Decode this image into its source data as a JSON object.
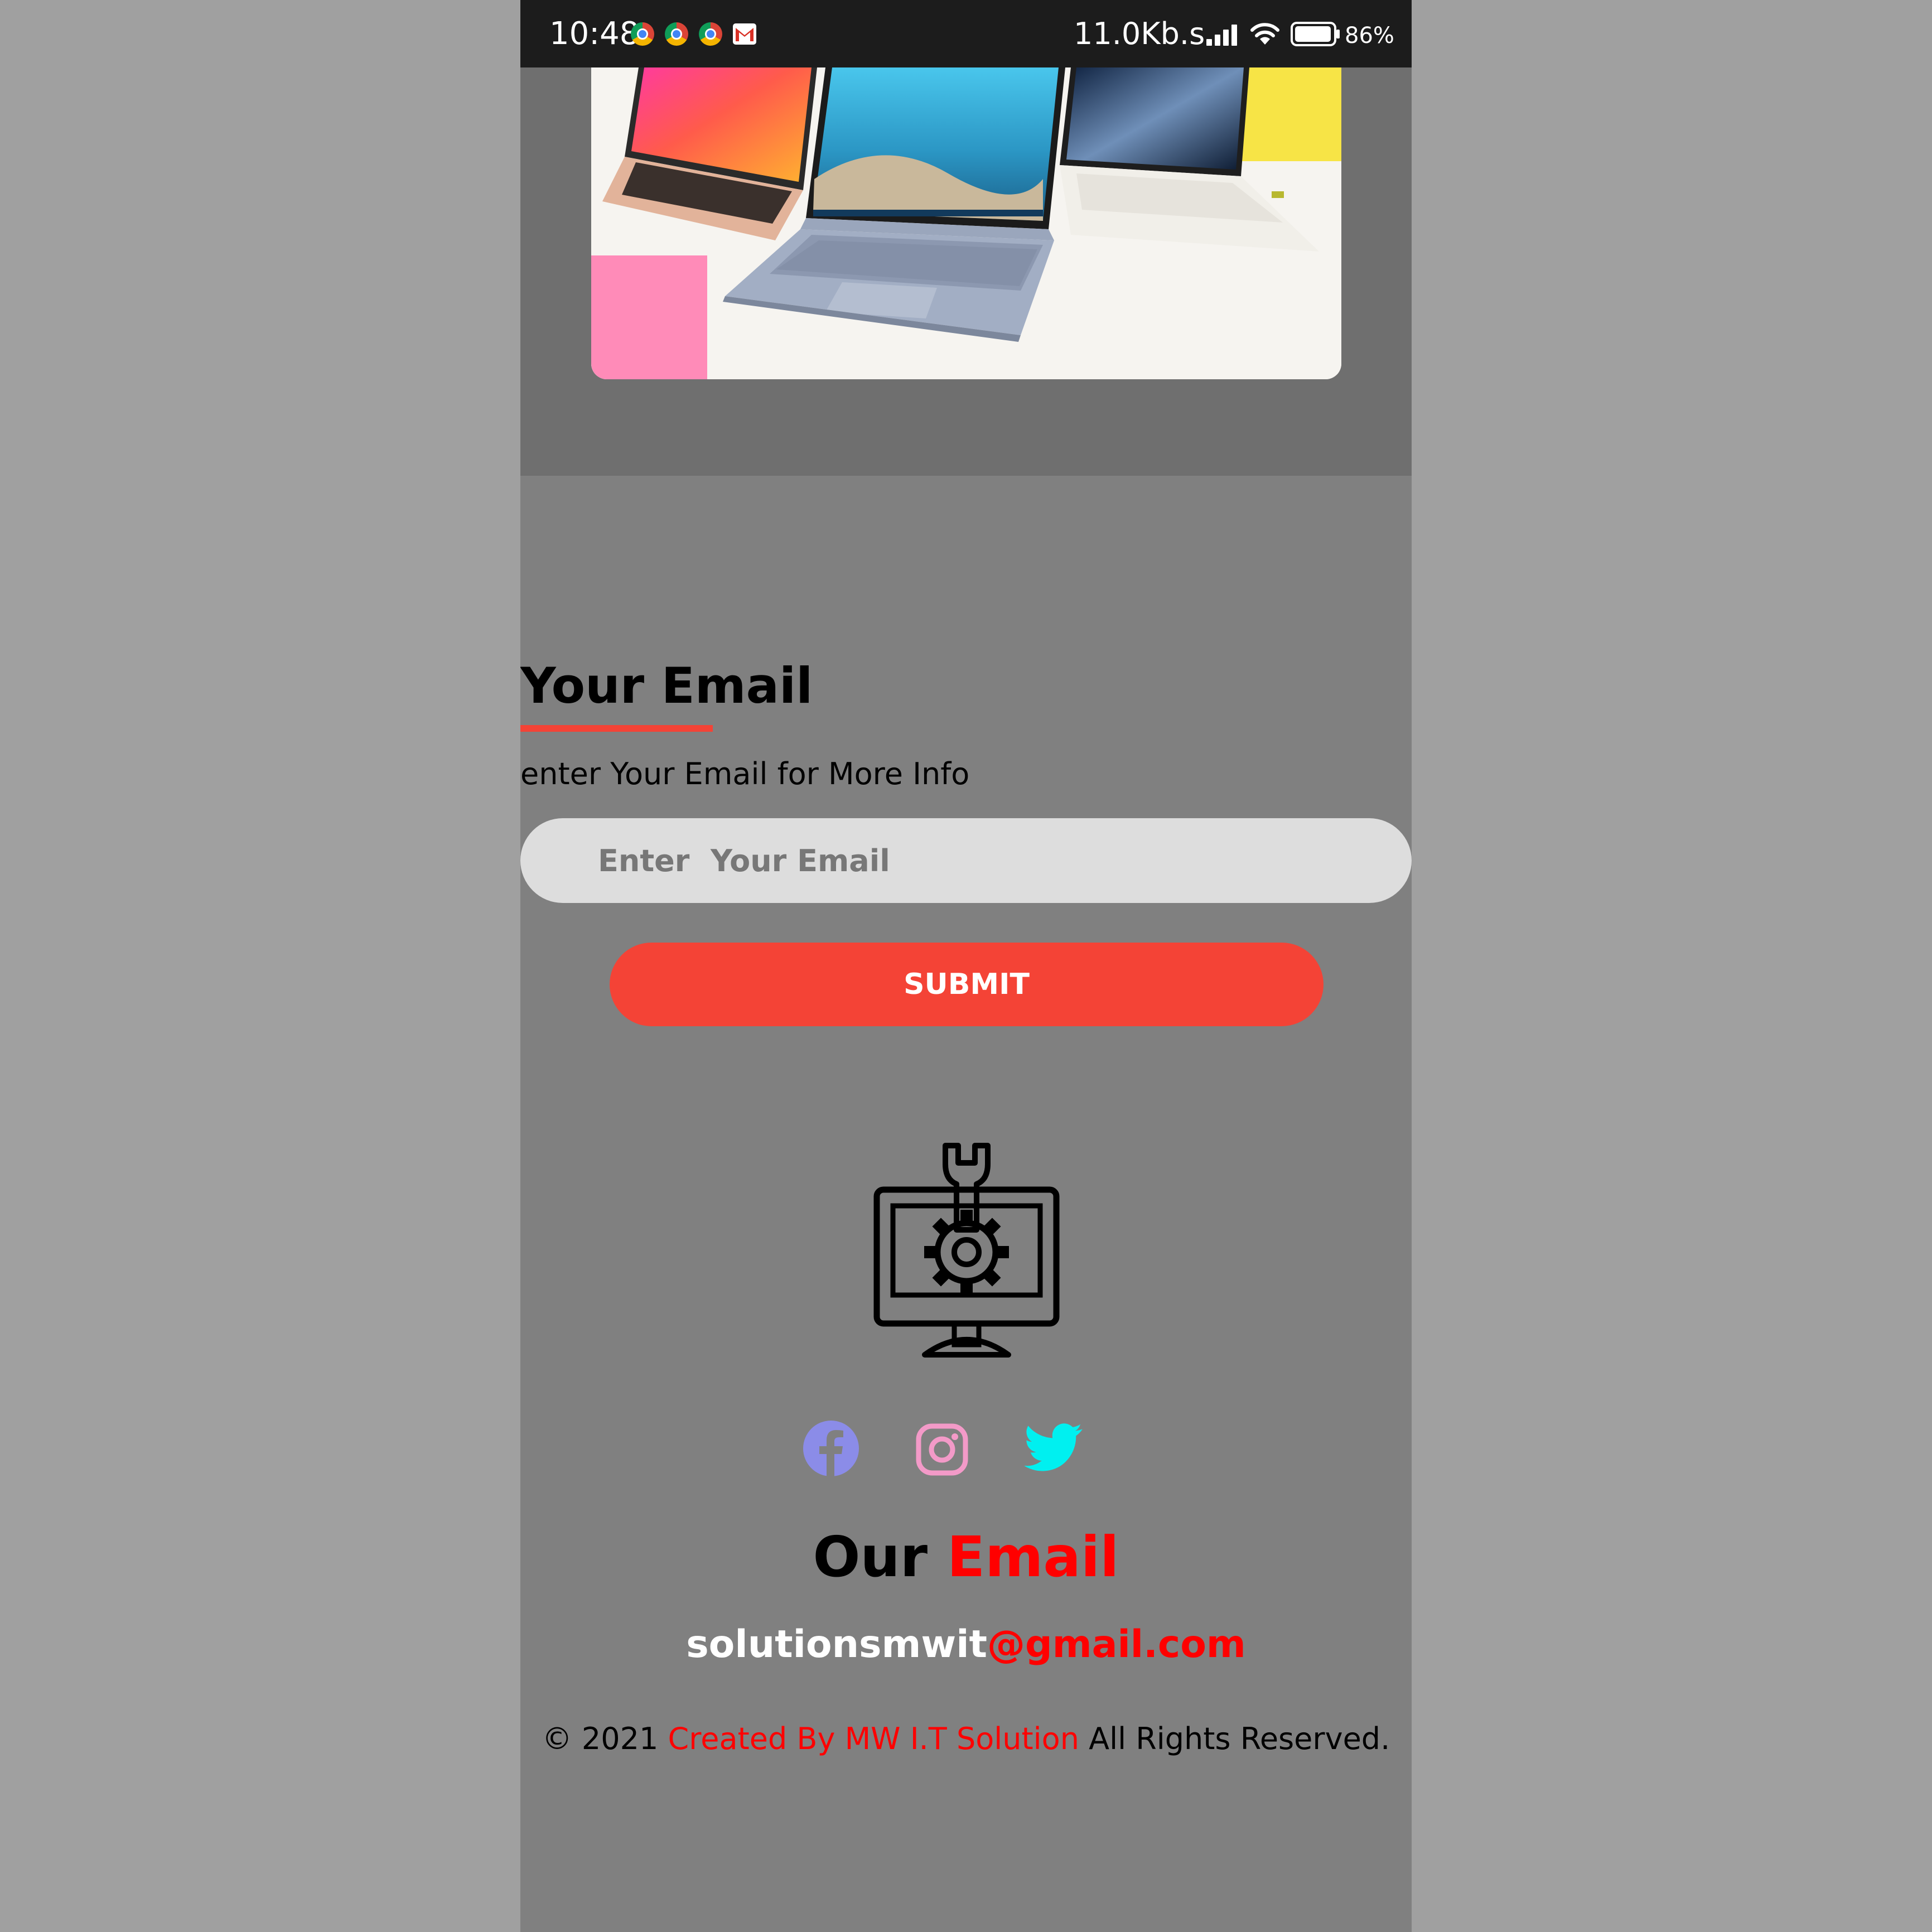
{
  "status_bar": {
    "time": "10:48",
    "notification_icons": [
      "chrome-icon",
      "chrome-icon",
      "chrome-icon",
      "gmail-icon"
    ],
    "network_speed": "11.0Kb.s",
    "battery_percent": "86%"
  },
  "hero": {
    "image_alt": "laptops"
  },
  "email_form": {
    "title": "Your Email",
    "subtitle": "enter Your Email for More Info",
    "input_placeholder": "Enter  Your Email",
    "submit_label": "SUBMIT"
  },
  "footer": {
    "logo_icon": "computer-settings-icon",
    "social": [
      {
        "name": "facebook-icon",
        "color": "#8b8ce8"
      },
      {
        "name": "instagram-icon",
        "color": "#f39ac8"
      },
      {
        "name": "twitter-icon",
        "color": "#00f0f0"
      }
    ],
    "heading_part1": "Our",
    "heading_part2": "Email",
    "email_user": "solutionsmwit",
    "email_domain": "@gmail.com",
    "copyright_prefix": "© 2021",
    "copyright_credit": "Created By MW I.T Solution",
    "copyright_suffix": "All Rights Reserved."
  },
  "colors": {
    "accent": "#f44336",
    "highlight": "#ff0000",
    "page_background": "#808080",
    "hero_background": "#6f6f6f",
    "input_background": "#dddddd"
  }
}
